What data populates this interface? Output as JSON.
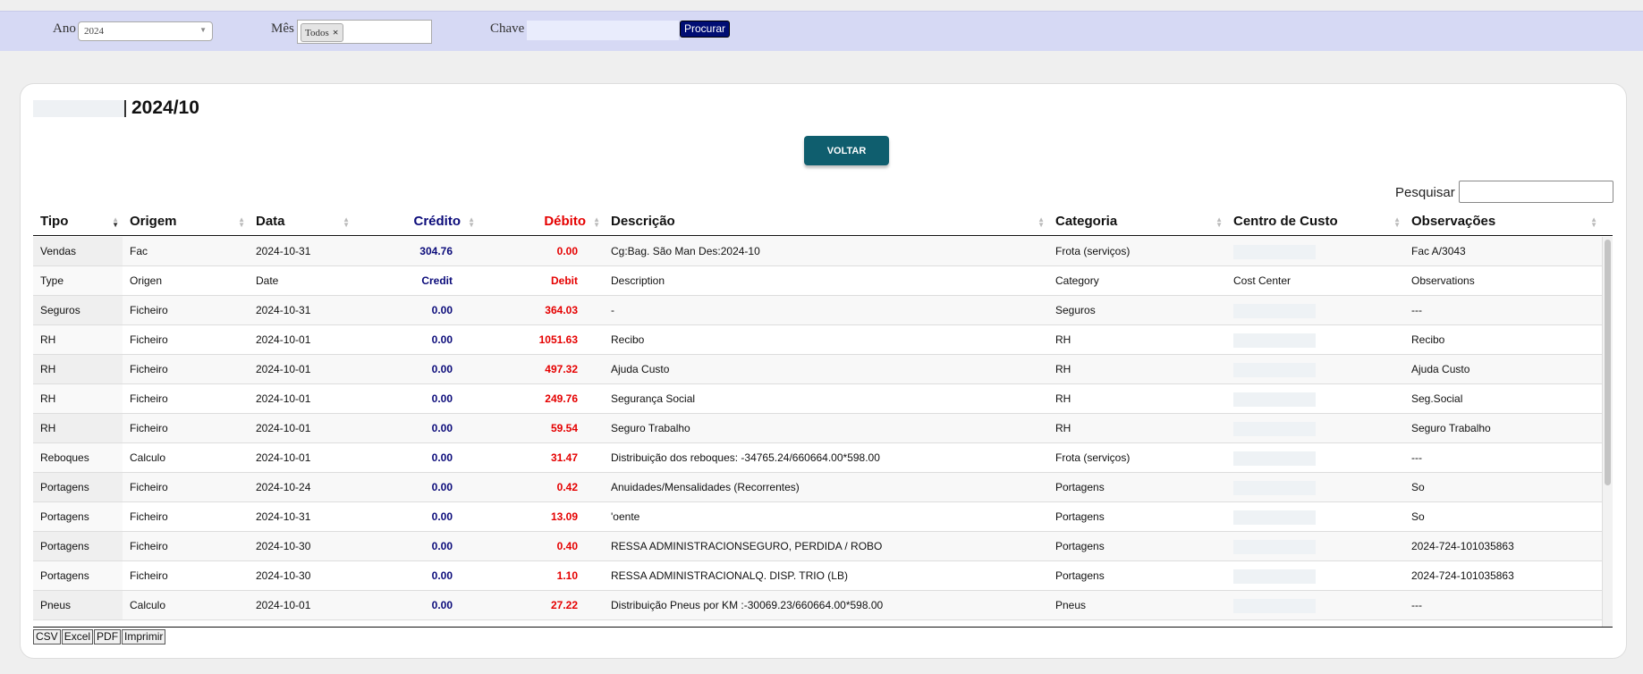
{
  "filters": {
    "year_label": "Ano",
    "year_value": "2024",
    "month_label": "Mês",
    "month_tag": "Todos",
    "key_label": "Chave",
    "key_value": "",
    "search_button": "Procurar"
  },
  "card": {
    "title": "2024/10",
    "back_button": "VOLTAR",
    "search_label": "Pesquisar"
  },
  "table": {
    "columns": {
      "tipo": "Tipo",
      "origem": "Origem",
      "data": "Data",
      "credito": "Crédito",
      "debito": "Débito",
      "descricao": "Descrição",
      "categoria": "Categoria",
      "centro": "Centro de Custo",
      "observacoes": "Observações"
    },
    "rows": [
      {
        "tipo": "Vendas",
        "origem": "Fac",
        "data": "2024-10-31",
        "credito": "304.76",
        "debito": "0.00",
        "descricao": "Cg:Bag.            São Man            Des:2024-10",
        "categoria": "Frota (serviços)",
        "centro": "",
        "obs": "Fac A/3043"
      },
      {
        "tipo": "Type",
        "origem": "Origen",
        "data": "Date",
        "credito": "Credit",
        "debito": "Debit",
        "descricao": "Description",
        "categoria": "Category",
        "centro": "Cost Center",
        "obs": "Observations"
      },
      {
        "tipo": "Seguros",
        "origem": "Ficheiro",
        "data": "2024-10-31",
        "credito": "0.00",
        "debito": "364.03",
        "descricao": "-",
        "categoria": "Seguros",
        "centro": "",
        "obs": "---"
      },
      {
        "tipo": "RH",
        "origem": "Ficheiro",
        "data": "2024-10-01",
        "credito": "0.00",
        "debito": "1051.63",
        "descricao": "Recibo",
        "categoria": "RH",
        "centro": "",
        "obs": "Recibo"
      },
      {
        "tipo": "RH",
        "origem": "Ficheiro",
        "data": "2024-10-01",
        "credito": "0.00",
        "debito": "497.32",
        "descricao": "Ajuda Custo",
        "categoria": "RH",
        "centro": "",
        "obs": "Ajuda Custo"
      },
      {
        "tipo": "RH",
        "origem": "Ficheiro",
        "data": "2024-10-01",
        "credito": "0.00",
        "debito": "249.76",
        "descricao": "Segurança Social",
        "categoria": "RH",
        "centro": "",
        "obs": "Seg.Social"
      },
      {
        "tipo": "RH",
        "origem": "Ficheiro",
        "data": "2024-10-01",
        "credito": "0.00",
        "debito": "59.54",
        "descricao": "Seguro Trabalho",
        "categoria": "RH",
        "centro": "",
        "obs": "Seguro Trabalho"
      },
      {
        "tipo": "Reboques",
        "origem": "Calculo",
        "data": "2024-10-01",
        "credito": "0.00",
        "debito": "31.47",
        "descricao": "Distribuição dos reboques: -34765.24/660664.00*598.00",
        "categoria": "Frota (serviços)",
        "centro": "",
        "obs": "---"
      },
      {
        "tipo": "Portagens",
        "origem": "Ficheiro",
        "data": "2024-10-24",
        "credito": "0.00",
        "debito": "0.42",
        "descricao": "Anuidades/Mensalidades (Recorrentes)",
        "categoria": "Portagens",
        "centro": "",
        "obs": "So"
      },
      {
        "tipo": "Portagens",
        "origem": "Ficheiro",
        "data": "2024-10-31",
        "credito": "0.00",
        "debito": "13.09",
        "descricao": "          'oente",
        "categoria": "Portagens",
        "centro": "",
        "obs": "So"
      },
      {
        "tipo": "Portagens",
        "origem": "Ficheiro",
        "data": "2024-10-30",
        "credito": "0.00",
        "debito": "0.40",
        "descricao": "RESSA ADMINISTRACIONSEGURO, PERDIDA / ROBO",
        "categoria": "Portagens",
        "centro": "",
        "obs": "2024-724-101035863"
      },
      {
        "tipo": "Portagens",
        "origem": "Ficheiro",
        "data": "2024-10-30",
        "credito": "0.00",
        "debito": "1.10",
        "descricao": "RESSA ADMINISTRACIONALQ. DISP. TRIO (LB)",
        "categoria": "Portagens",
        "centro": "",
        "obs": "2024-724-101035863"
      },
      {
        "tipo": "Pneus",
        "origem": "Calculo",
        "data": "2024-10-01",
        "credito": "0.00",
        "debito": "27.22",
        "descricao": "Distribuição Pneus por KM :-30069.23/660664.00*598.00",
        "categoria": "Pneus",
        "centro": "",
        "obs": "---"
      }
    ]
  },
  "export": {
    "csv": "CSV",
    "excel": "Excel",
    "pdf": "PDF",
    "print": "Imprimir"
  },
  "colors": {
    "credit": "#0b0b7a",
    "debit": "#e50000",
    "accent": "#0f5e6e",
    "filter_bar": "#d6d9f4",
    "search_button": "#000d73"
  }
}
